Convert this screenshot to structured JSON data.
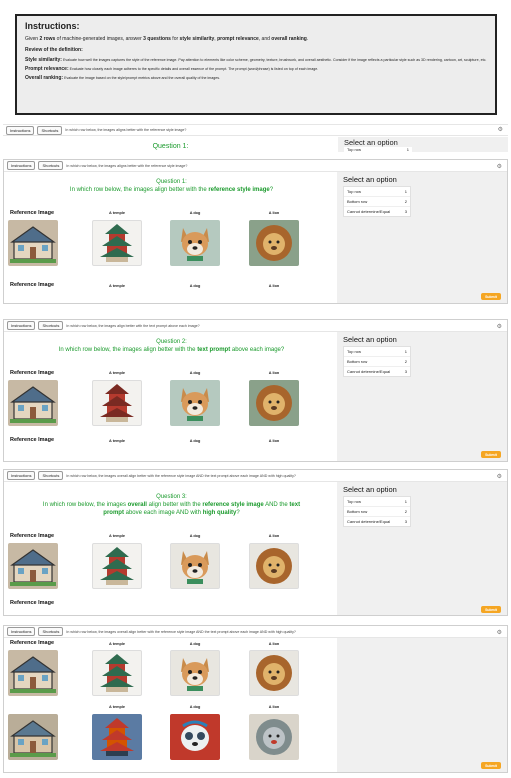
{
  "instructions": {
    "title": "Instructions:",
    "given_pre": "Given ",
    "given_b1": "2 rows",
    "given_m1": " of machine-generated images, answer ",
    "given_b2": "3 questions",
    "given_m2": " for ",
    "given_b3": "style similarity",
    "given_m3": ", ",
    "given_b4": "prompt relevance",
    "given_m4": ", and ",
    "given_b5": "overall ranking",
    "given_end": ".",
    "review": "Review of the definition:",
    "style_label": "Style similarity:",
    "style_text": "Evaluate how well the images captures the style of the reference image. Pay attention to elements like color scheme, geometry, texture, brushwork, and overall aesthetic. Consider if the image reflects a particular style such as 3D rendering, cartoon, art, sculpture, etc.",
    "prompt_label": "Prompt relevance:",
    "prompt_text": "Evaluate how closely each image adheres to the specific details and overall essence of the prompt. The prompt (word/phrase) is listed on top of each image.",
    "overall_label": "Overall ranking:",
    "overall_text": "Evaluate the image based on the style/prompt metrics above and the overall quality of the images."
  },
  "toolbar": {
    "instructions": "Instructions",
    "shortcuts": "Shortcuts"
  },
  "questions": {
    "q1_text": "In which row below, the images aligns better with the reference style image?",
    "q2_text": "In which row below, the images align better with the text prompt above each image?",
    "q3_text": "In which row below, the images overall align better with the reference style image AND the text prompt above each image AND with high quality?",
    "q1_title": "Question 1:",
    "q2_title": "Question 2:",
    "q3_title": "Question 3:",
    "q1_pre": "In which row below, the images align better with the ",
    "q1_b": "reference style image",
    "q1_end": "?",
    "q2_pre": "In which row below, the images align better with the ",
    "q2_b": "text prompt",
    "q2_end": " above each image?",
    "q3_pre": "In which row below, the images ",
    "q3_b1": "overall",
    "q3_m1": " align better with the ",
    "q3_b2": "reference style image",
    "q3_m2": " AND the ",
    "q3_b3": "text prompt",
    "q3_m3": " above each image AND with ",
    "q3_b4": "high quality",
    "q3_end": "?"
  },
  "select": {
    "title": "Select an option",
    "top": "Top row",
    "top_key": "1",
    "bottom": "Bottom row",
    "bottom_key": "2",
    "equal": "Cannot determine/Equal",
    "equal_key": "3"
  },
  "labels": {
    "reference": "Reference Image",
    "temple": "A temple",
    "dog": "A dog",
    "lion": "A lion"
  },
  "submit": "Submit",
  "colors": {
    "accent_green": "#1a9a2c",
    "submit_orange": "#f5a623",
    "panel_gray": "#f0f0f0"
  }
}
